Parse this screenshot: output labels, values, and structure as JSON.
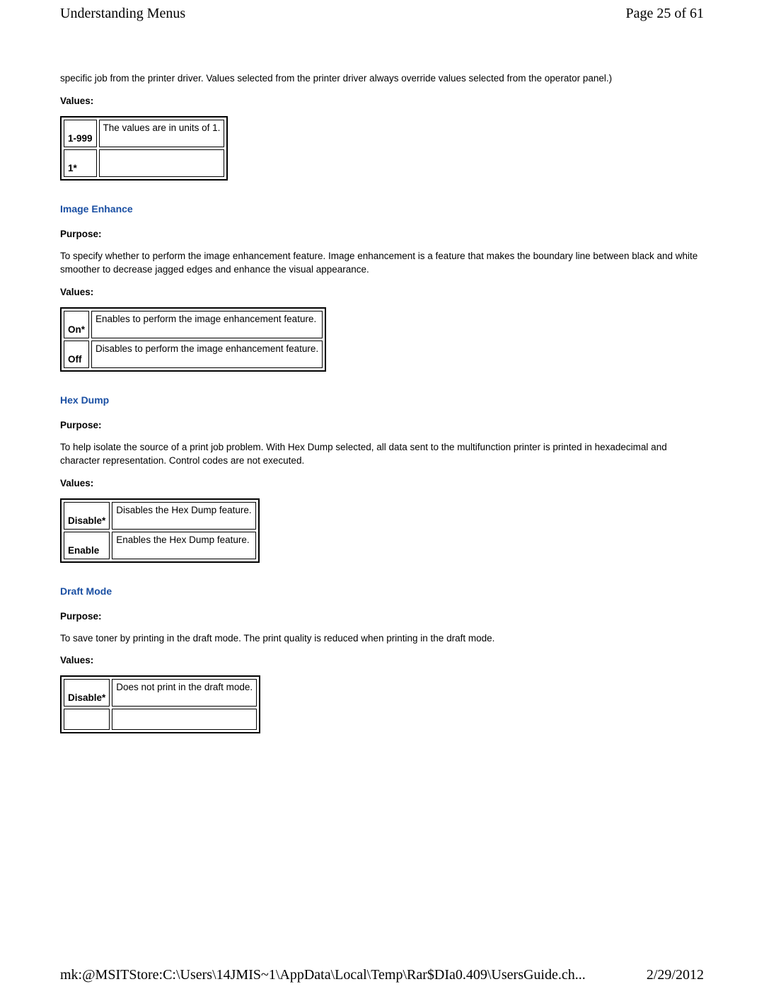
{
  "header": {
    "title": "Understanding Menus",
    "page_info": "Page 25 of 61"
  },
  "intro_para": "specific job from the printer driver. Values selected from the printer driver always override values selected from the operator panel.)",
  "values_label": "Values:",
  "purpose_label": "Purpose:",
  "table_quantity": {
    "r1k": "1-999",
    "r1v": "The values are in units of 1.",
    "r2k": "1*",
    "r2v": ""
  },
  "image_enhance": {
    "heading": "Image Enhance",
    "purpose_text": "To specify whether to perform the image enhancement feature. Image enhancement is a feature that makes the boundary line between black and white smoother to decrease jagged edges and enhance the visual appearance.",
    "r1k": "On*",
    "r1v": "Enables to perform the image enhancement feature.",
    "r2k": "Off",
    "r2v": "Disables to perform the image enhancement feature."
  },
  "hex_dump": {
    "heading": "Hex Dump",
    "purpose_text": "To help isolate the source of a print job problem. With Hex Dump selected, all data sent to the multifunction printer is printed in hexadecimal and character representation. Control codes are not executed.",
    "r1k": "Disable*",
    "r1v": "Disables the Hex Dump feature.",
    "r2k": "Enable",
    "r2v": "Enables the Hex Dump feature."
  },
  "draft_mode": {
    "heading": "Draft Mode",
    "purpose_text": "To save toner by printing in the draft mode. The print quality is reduced when printing in the draft mode.",
    "r1k": "Disable*",
    "r1v": "Does not print in the draft mode.",
    "r2k": "",
    "r2v": ""
  },
  "footer": {
    "path": "mk:@MSITStore:C:\\Users\\14JMIS~1\\AppData\\Local\\Temp\\Rar$DIa0.409\\UsersGuide.ch...",
    "date": "2/29/2012"
  }
}
